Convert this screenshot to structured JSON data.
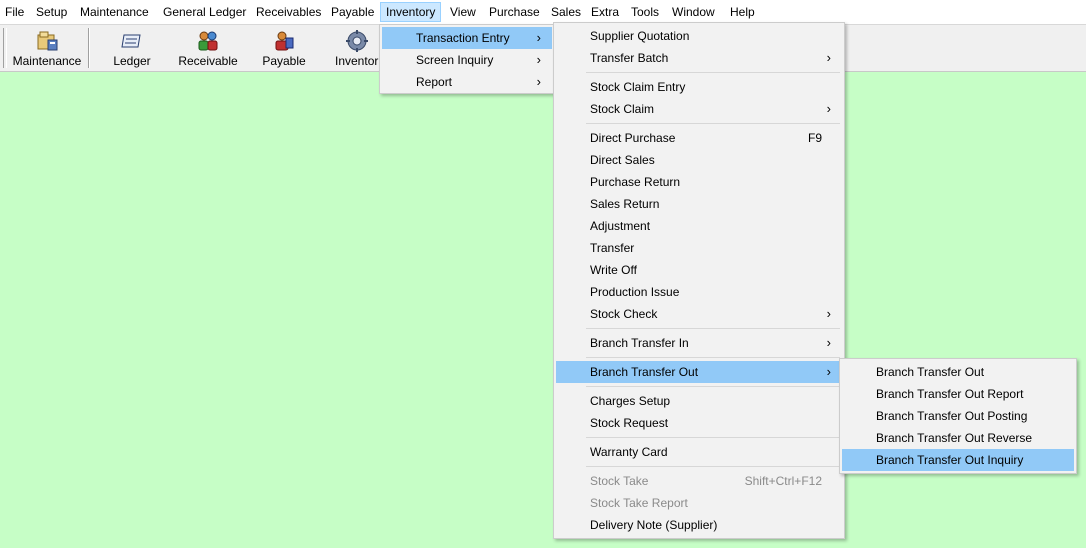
{
  "menubar": {
    "items": [
      "File",
      "Setup",
      "Maintenance",
      "General Ledger",
      "Receivables",
      "Payable",
      "Inventory",
      "View",
      "Purchase",
      "Sales",
      "Extra",
      "Tools",
      "Window",
      "Help"
    ],
    "active": "Inventory"
  },
  "toolbar": {
    "buttons": [
      {
        "label": "Maintenance",
        "icon": "maintenance-icon"
      },
      {
        "label": "Ledger",
        "icon": "ledger-icon"
      },
      {
        "label": "Receivable",
        "icon": "receivable-icon"
      },
      {
        "label": "Payable",
        "icon": "payable-icon"
      },
      {
        "label": "Inventor",
        "icon": "inventory-gear-icon"
      }
    ]
  },
  "inventory_menu": {
    "items": [
      {
        "label": "Transaction Entry",
        "submenu": true,
        "highlighted": true
      },
      {
        "label": "Screen Inquiry",
        "submenu": true
      },
      {
        "label": "Report",
        "submenu": true
      }
    ]
  },
  "transaction_entry_menu": {
    "groups": [
      [
        {
          "label": "Supplier Quotation"
        },
        {
          "label": "Transfer Batch",
          "submenu": true
        }
      ],
      [
        {
          "label": "Stock Claim Entry"
        },
        {
          "label": "Stock Claim",
          "submenu": true
        }
      ],
      [
        {
          "label": "Direct Purchase",
          "shortcut": "F9"
        },
        {
          "label": "Direct Sales"
        },
        {
          "label": "Purchase Return"
        },
        {
          "label": "Sales Return"
        },
        {
          "label": "Adjustment"
        },
        {
          "label": "Transfer"
        },
        {
          "label": "Write Off"
        },
        {
          "label": "Production Issue"
        },
        {
          "label": "Stock Check",
          "submenu": true
        }
      ],
      [
        {
          "label": "Branch Transfer In",
          "submenu": true
        }
      ],
      [
        {
          "label": "Branch Transfer Out",
          "submenu": true,
          "highlighted": true
        }
      ],
      [
        {
          "label": "Charges Setup"
        },
        {
          "label": "Stock Request"
        }
      ],
      [
        {
          "label": "Warranty Card"
        }
      ],
      [
        {
          "label": "Stock Take",
          "shortcut": "Shift+Ctrl+F12",
          "disabled": true
        },
        {
          "label": "Stock Take Report",
          "disabled": true
        },
        {
          "label": "Delivery Note (Supplier)"
        }
      ]
    ]
  },
  "branch_transfer_out_menu": {
    "items": [
      {
        "label": "Branch Transfer Out"
      },
      {
        "label": "Branch Transfer Out Report"
      },
      {
        "label": "Branch Transfer Out Posting"
      },
      {
        "label": "Branch Transfer Out Reverse"
      },
      {
        "label": "Branch Transfer Out Inquiry",
        "highlighted": true
      }
    ]
  },
  "colors": {
    "background": "#c6fec6",
    "menu_highlight": "#91c9f7",
    "menubar_active": "#cce8ff"
  }
}
